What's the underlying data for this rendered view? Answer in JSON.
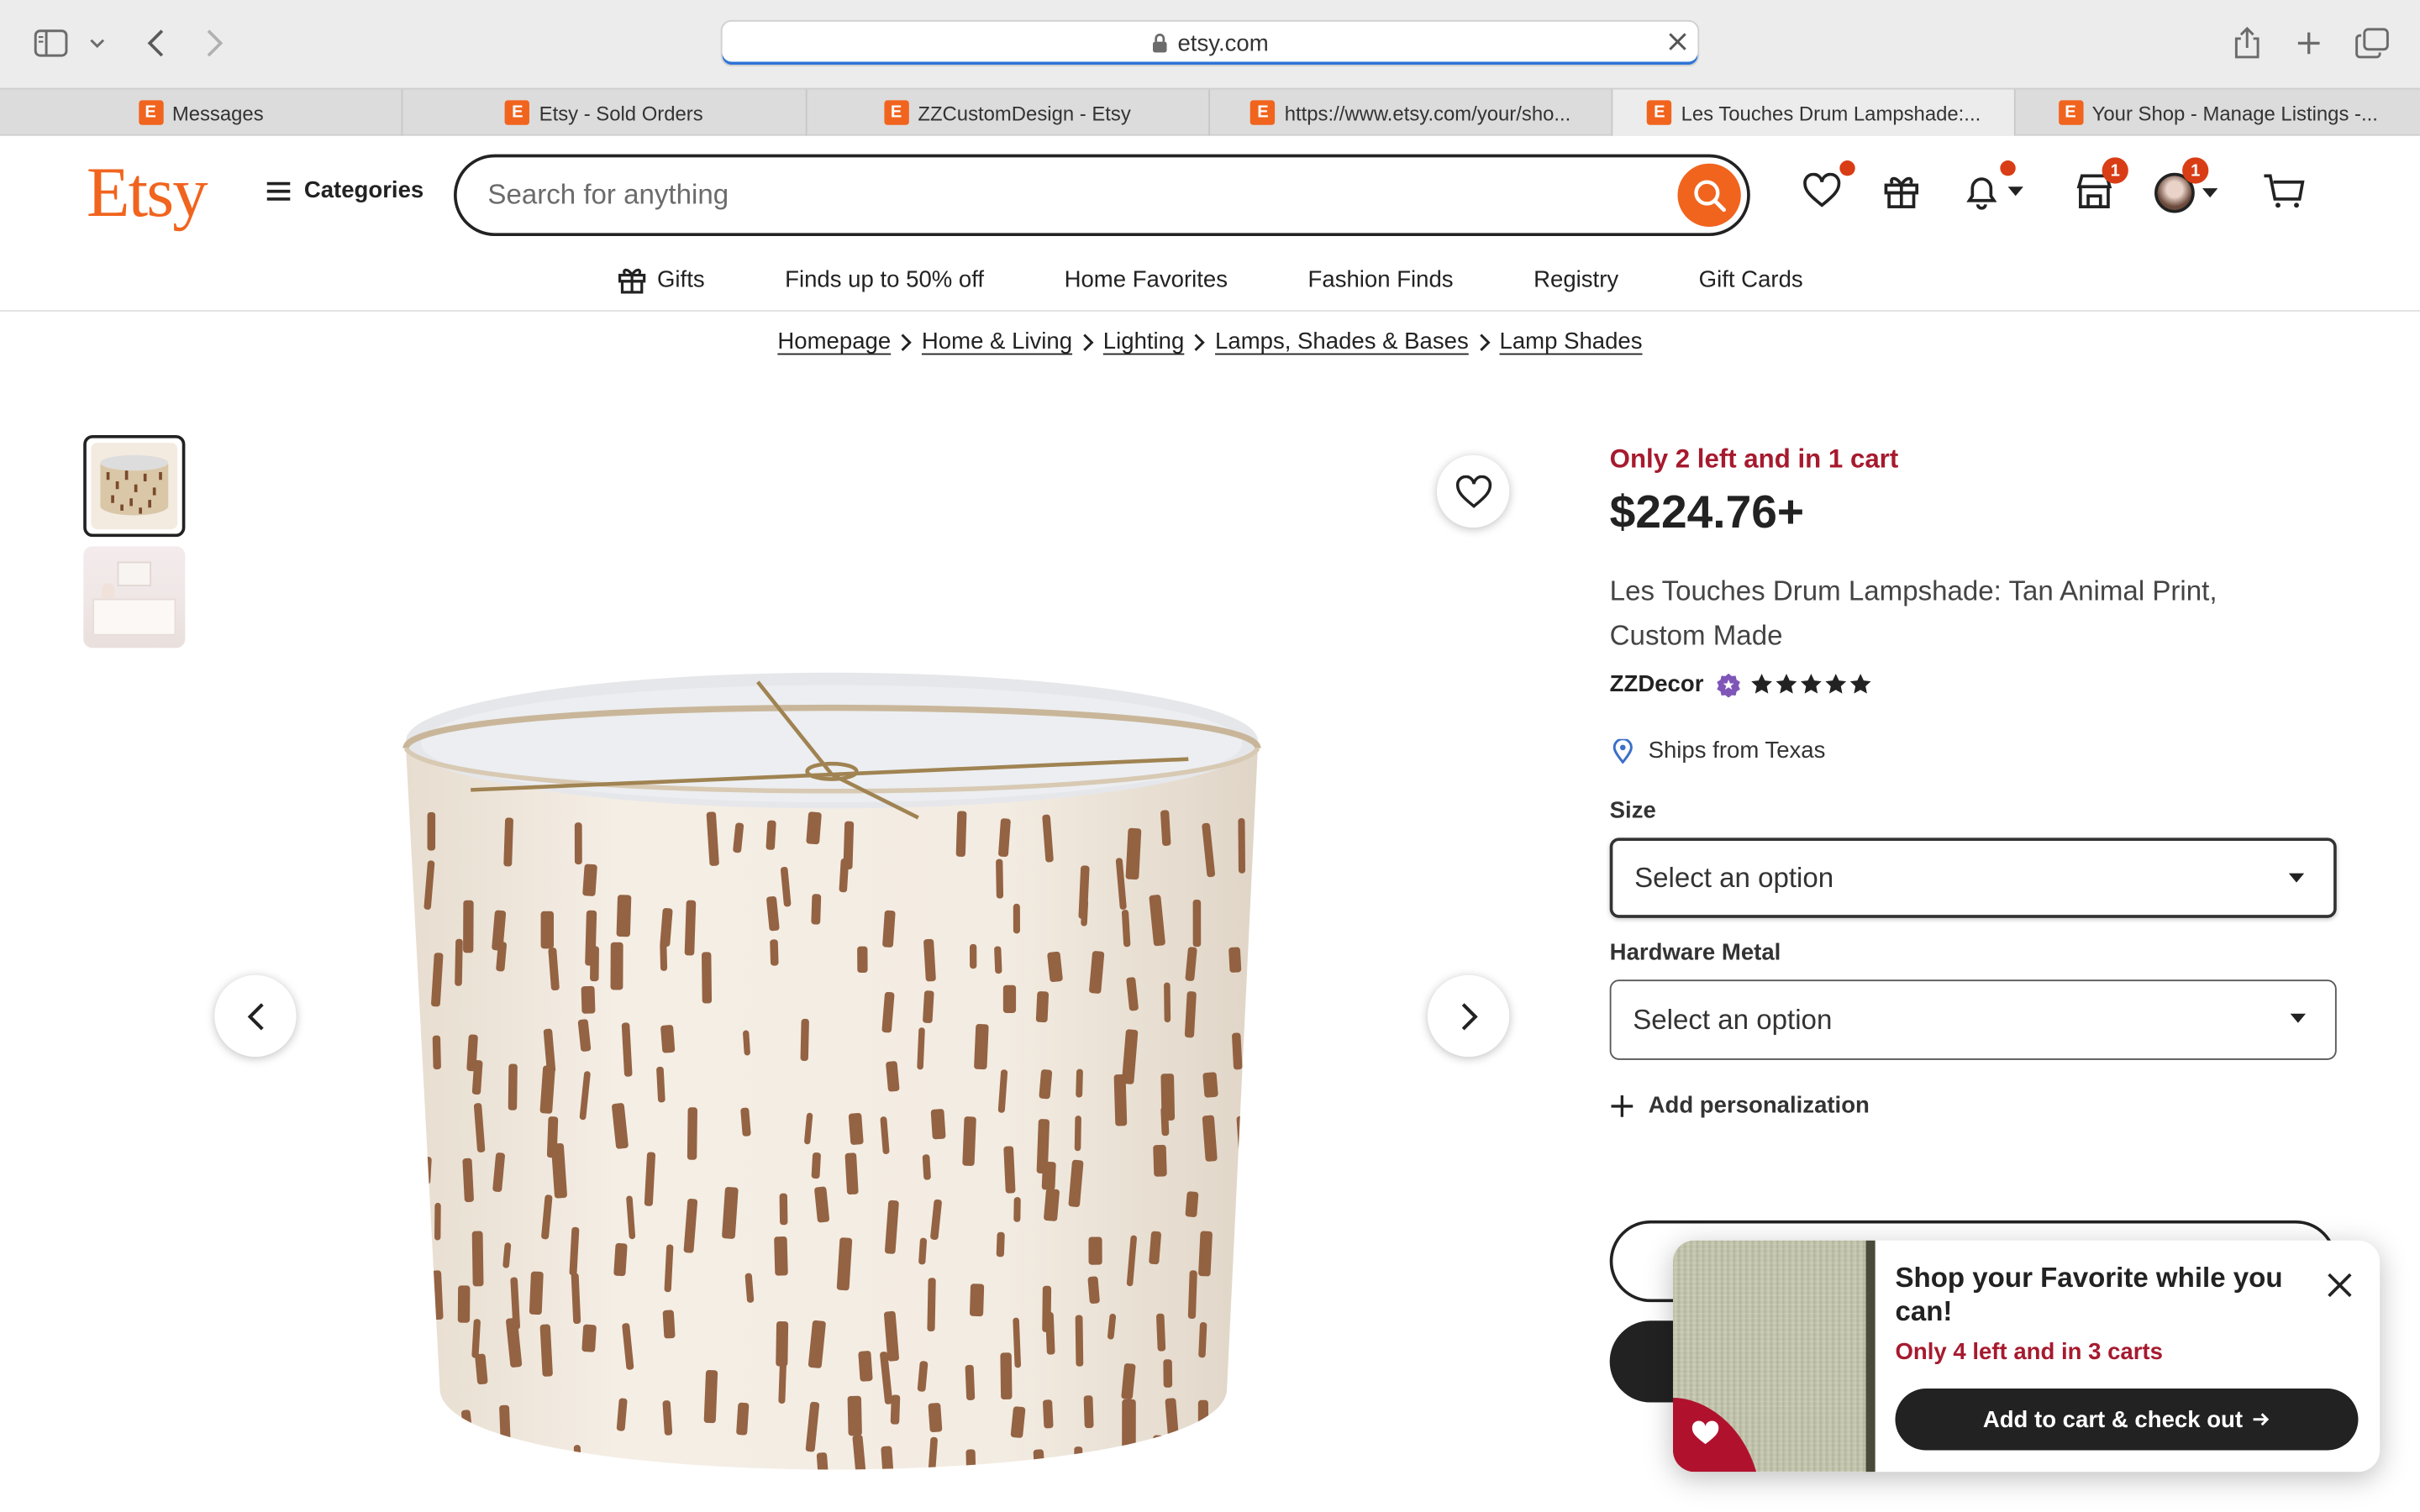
{
  "browser": {
    "url": "etsy.com",
    "tabs": [
      {
        "label": "Messages"
      },
      {
        "label": "Etsy - Sold Orders"
      },
      {
        "label": "ZZCustomDesign - Etsy"
      },
      {
        "label": "https://www.etsy.com/your/sho..."
      },
      {
        "label": "Les Touches Drum Lampshade:..."
      },
      {
        "label": "Your Shop - Manage Listings -..."
      }
    ],
    "favicon_letter": "E"
  },
  "header": {
    "logo": "Etsy",
    "categories_label": "Categories",
    "search_placeholder": "Search for anything",
    "cart_badge": "1",
    "account_badge": "1"
  },
  "subnav": {
    "items": [
      {
        "label": "Gifts"
      },
      {
        "label": "Finds up to 50% off"
      },
      {
        "label": "Home Favorites"
      },
      {
        "label": "Fashion Finds"
      },
      {
        "label": "Registry"
      },
      {
        "label": "Gift Cards"
      }
    ]
  },
  "breadcrumb": [
    "Homepage",
    "Home & Living",
    "Lighting",
    "Lamps, Shades & Bases",
    "Lamp Shades"
  ],
  "product": {
    "stock_note": "Only 2 left and in 1 cart",
    "price": "$224.76+",
    "title": "Les Touches Drum Lampshade: Tan Animal Print, Custom Made",
    "shop_name": "ZZDecor",
    "rating": 5,
    "ships_from": "Ships from Texas",
    "size_label": "Size",
    "size_value": "Select an option",
    "hardware_label": "Hardware Metal",
    "hardware_value": "Select an option",
    "personalization_label": "Add personalization"
  },
  "popup": {
    "title": "Shop your Favorite while you can!",
    "stock_note": "Only 4 left and in 3 carts",
    "button_label": "Add to cart & check out"
  },
  "colors": {
    "brand_orange": "#f1641e",
    "stock_red": "#a61a2e",
    "badge_red": "#d93d16"
  },
  "icons": [
    "sidebar-icon",
    "back-icon",
    "forward-icon",
    "lock-icon",
    "share-icon",
    "new-tab-icon",
    "tabs-overview-icon",
    "search-icon",
    "heart-icon",
    "gift-icon",
    "bell-icon",
    "shop-icon",
    "cart-icon",
    "star-seller-icon",
    "map-pin-icon",
    "plus-icon",
    "close-icon"
  ]
}
